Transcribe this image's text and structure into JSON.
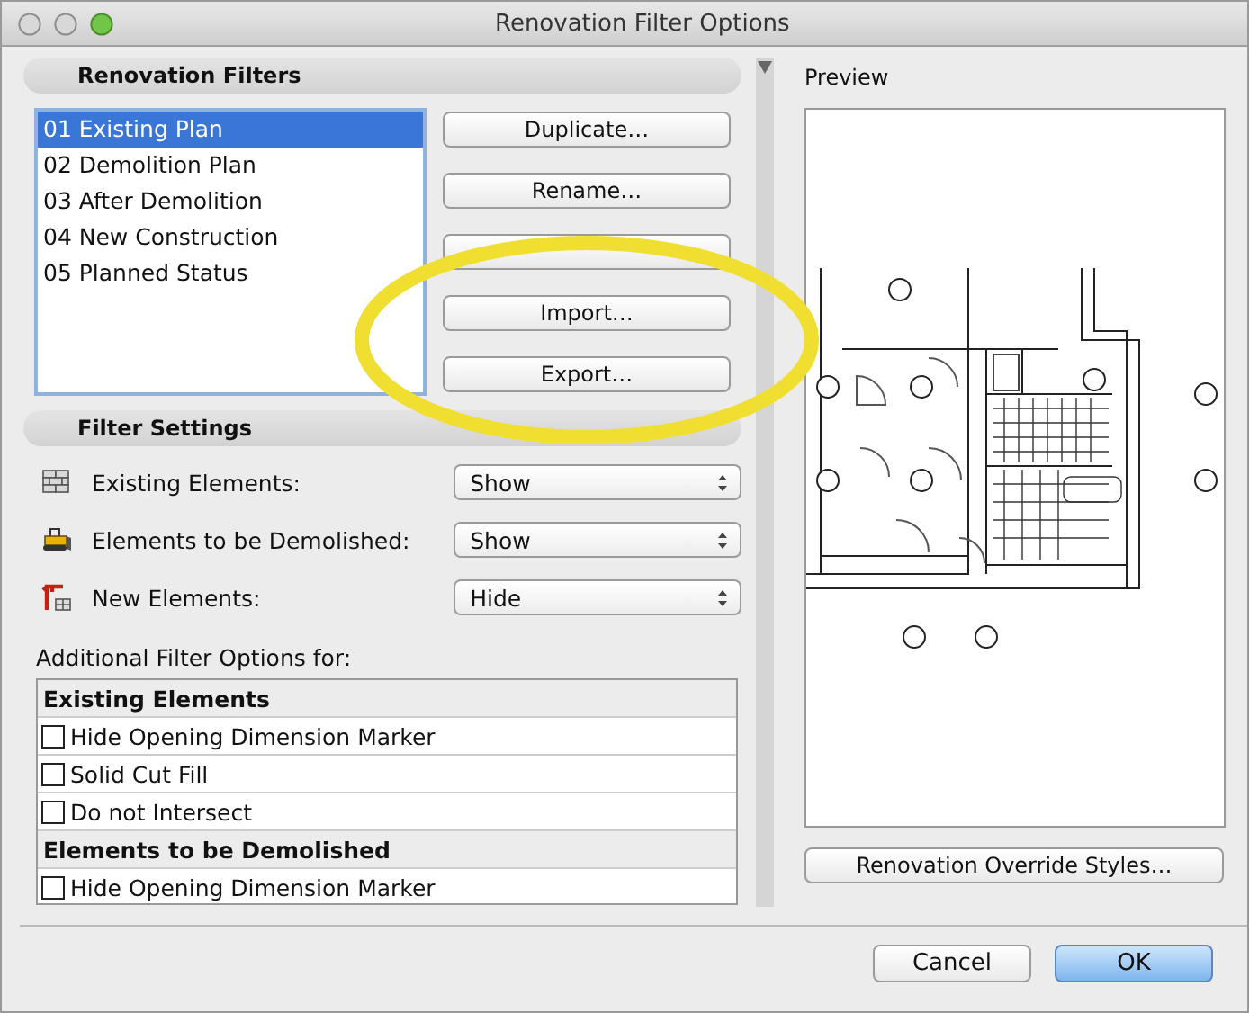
{
  "window": {
    "title": "Renovation Filter Options"
  },
  "renovation_filters": {
    "header": "Renovation Filters",
    "items": [
      {
        "label": "01 Existing Plan",
        "selected": true
      },
      {
        "label": "02 Demolition Plan",
        "selected": false
      },
      {
        "label": "03 After Demolition",
        "selected": false
      },
      {
        "label": "04 New Construction",
        "selected": false
      },
      {
        "label": "05 Planned Status",
        "selected": false
      }
    ],
    "buttons": [
      {
        "kind": "labeled",
        "label": "Duplicate…"
      },
      {
        "kind": "labeled",
        "label": "Rename…"
      },
      {
        "kind": "covered"
      },
      {
        "kind": "labeled",
        "label": "Import…"
      },
      {
        "kind": "labeled",
        "label": "Export…"
      }
    ]
  },
  "filter_settings": {
    "header": "Filter Settings",
    "rows": [
      {
        "kind": "existing",
        "label": "Existing Elements:",
        "value": "Show"
      },
      {
        "kind": "demolished",
        "label": "Elements to be Demolished:",
        "value": "Show"
      },
      {
        "kind": "new",
        "label": "New Elements:",
        "value": "Hide"
      }
    ],
    "additional_label": "Additional Filter Options for:",
    "options": [
      {
        "kind": "group",
        "label": "Existing Elements"
      },
      {
        "kind": "option",
        "label": "Hide Opening Dimension Marker",
        "checked": false
      },
      {
        "kind": "option",
        "label": "Solid Cut Fill",
        "checked": false
      },
      {
        "kind": "option",
        "label": "Do not Intersect",
        "checked": false
      },
      {
        "kind": "group",
        "label": "Elements to be Demolished"
      },
      {
        "kind": "option",
        "label": "Hide Opening Dimension Marker",
        "checked": false
      }
    ]
  },
  "preview": {
    "label": "Preview",
    "button": "Renovation Override Styles…"
  },
  "dialog_buttons": [
    {
      "label": "Cancel",
      "default": false
    },
    {
      "label": "OK",
      "default": true
    }
  ]
}
